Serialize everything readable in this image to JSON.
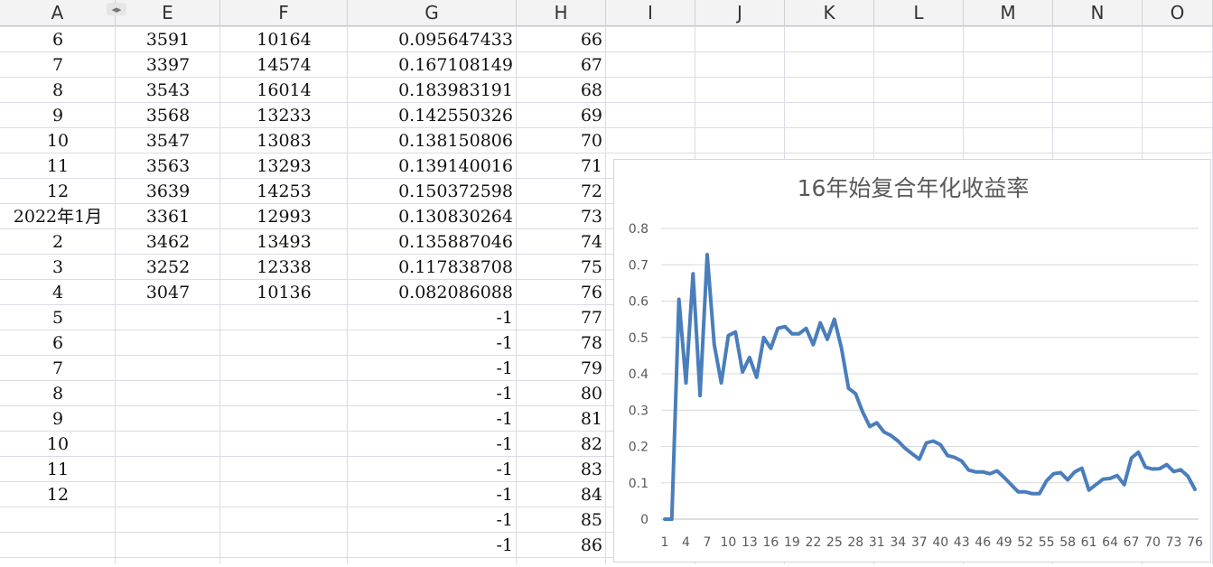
{
  "sheet": {
    "columns": [
      "A",
      "E",
      "F",
      "G",
      "H",
      "I",
      "J",
      "K",
      "L",
      "M",
      "N",
      "O"
    ],
    "rows": [
      {
        "A": "6",
        "E": "3591",
        "F": "10164",
        "G": "0.095647433",
        "H": "66"
      },
      {
        "A": "7",
        "E": "3397",
        "F": "14574",
        "G": "0.167108149",
        "H": "67"
      },
      {
        "A": "8",
        "E": "3543",
        "F": "16014",
        "G": "0.183983191",
        "H": "68"
      },
      {
        "A": "9",
        "E": "3568",
        "F": "13233",
        "G": "0.142550326",
        "H": "69"
      },
      {
        "A": "10",
        "E": "3547",
        "F": "13083",
        "G": "0.138150806",
        "H": "70"
      },
      {
        "A": "11",
        "E": "3563",
        "F": "13293",
        "G": "0.139140016",
        "H": "71"
      },
      {
        "A": "12",
        "E": "3639",
        "F": "14253",
        "G": "0.150372598",
        "H": "72"
      },
      {
        "A": "2022年1月",
        "E": "3361",
        "F": "12993",
        "G": "0.130830264",
        "H": "73"
      },
      {
        "A": "2",
        "E": "3462",
        "F": "13493",
        "G": "0.135887046",
        "H": "74"
      },
      {
        "A": "3",
        "E": "3252",
        "F": "12338",
        "G": "0.117838708",
        "H": "75"
      },
      {
        "A": "4",
        "E": "3047",
        "F": "10136",
        "G": "0.082086088",
        "H": "76"
      },
      {
        "A": "5",
        "E": "",
        "F": "",
        "G": "-1",
        "H": "77"
      },
      {
        "A": "6",
        "E": "",
        "F": "",
        "G": "-1",
        "H": "78"
      },
      {
        "A": "7",
        "E": "",
        "F": "",
        "G": "-1",
        "H": "79"
      },
      {
        "A": "8",
        "E": "",
        "F": "",
        "G": "-1",
        "H": "80"
      },
      {
        "A": "9",
        "E": "",
        "F": "",
        "G": "-1",
        "H": "81"
      },
      {
        "A": "10",
        "E": "",
        "F": "",
        "G": "-1",
        "H": "82"
      },
      {
        "A": "11",
        "E": "",
        "F": "",
        "G": "-1",
        "H": "83"
      },
      {
        "A": "12",
        "E": "",
        "F": "",
        "G": "-1",
        "H": "84"
      },
      {
        "A": "",
        "E": "",
        "F": "",
        "G": "-1",
        "H": "85"
      },
      {
        "A": "",
        "E": "",
        "F": "",
        "G": "-1",
        "H": "86"
      }
    ],
    "hidden_columns_icon": "resize-arrows-icon"
  },
  "chart_data": {
    "type": "line",
    "title": "16年始复合年化收益率",
    "xlabel": "",
    "ylabel": "",
    "ylim": [
      0,
      0.8
    ],
    "yticks": [
      "0",
      "0.1",
      "0.2",
      "0.3",
      "0.4",
      "0.5",
      "0.6",
      "0.7",
      "0.8"
    ],
    "xticks": [
      "1",
      "4",
      "7",
      "10",
      "13",
      "16",
      "19",
      "22",
      "25",
      "28",
      "31",
      "34",
      "37",
      "40",
      "43",
      "46",
      "49",
      "52",
      "55",
      "58",
      "61",
      "64",
      "67",
      "70",
      "73",
      "76"
    ],
    "grid": true,
    "color": "#4a7ebb",
    "series": [
      {
        "values": [
          0,
          0,
          0.605,
          0.375,
          0.675,
          0.34,
          0.728,
          0.48,
          0.375,
          0.505,
          0.515,
          0.405,
          0.445,
          0.39,
          0.5,
          0.47,
          0.525,
          0.53,
          0.51,
          0.51,
          0.525,
          0.48,
          0.54,
          0.495,
          0.55,
          0.47,
          0.36,
          0.345,
          0.295,
          0.255,
          0.265,
          0.24,
          0.23,
          0.215,
          0.195,
          0.18,
          0.165,
          0.21,
          0.215,
          0.205,
          0.175,
          0.17,
          0.16,
          0.135,
          0.13,
          0.13,
          0.125,
          0.133,
          0.115,
          0.095,
          0.075,
          0.075,
          0.07,
          0.07,
          0.105,
          0.125,
          0.128,
          0.108,
          0.13,
          0.14,
          0.08,
          0.095,
          0.11,
          0.112,
          0.12,
          0.095,
          0.168,
          0.184,
          0.143,
          0.138,
          0.139,
          0.15,
          0.131,
          0.136,
          0.118,
          0.082
        ]
      }
    ]
  }
}
